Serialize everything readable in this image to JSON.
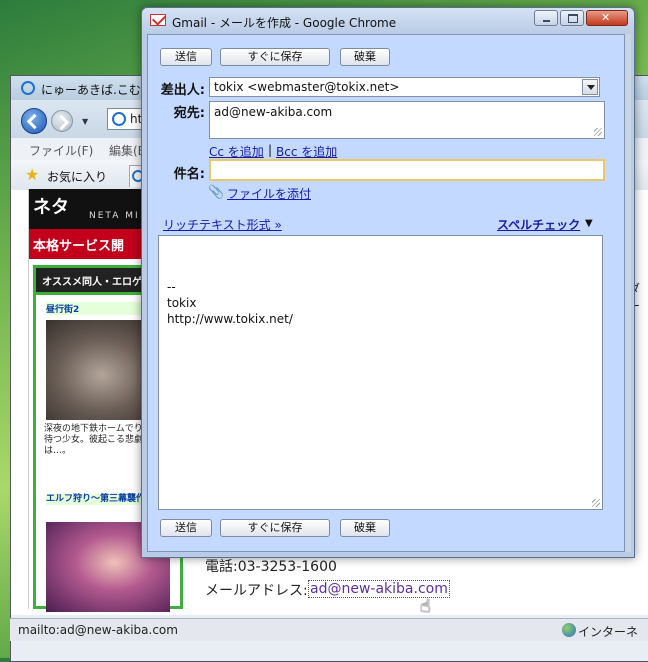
{
  "ie": {
    "title": "にゅーあきば.こむ",
    "address_text": "htt",
    "menu": [
      "ファイル(F)",
      "編集(E"
    ],
    "favorites_label": "お気に入り",
    "sidebar": {
      "banner_logo": "ネタ",
      "banner_sub": "NETA MI",
      "banner_text": "本格サービス開",
      "box_header": "オススメ同人・エロゲ",
      "item1_title": "昼行街2",
      "item1_desc": "深夜の地下鉄ホームでり電車を待つ少女。彼起こる悲劇とは…。",
      "item2_title": "エルフ狩り～第三幕襲作戦～"
    },
    "right_edge_1": "ダー",
    "right_edge_2": "",
    "phone_text": "電話:03-3253-1600",
    "email_label": "メールアドレス:",
    "email_link": "ad@new-akiba.com",
    "status_text": "mailto:ad@new-akiba.com",
    "zone_text": "インターネ"
  },
  "chrome": {
    "title": "Gmail - メールを作成 - Google Chrome",
    "buttons": {
      "send": "送信",
      "save": "すぐに保存",
      "discard": "破棄"
    },
    "from_label": "差出人:",
    "from_value": "tokix <webmaster@tokix.net>",
    "to_label": "宛先:",
    "to_value": "ad@new-akiba.com",
    "cc_link": "Cc を追加",
    "separator": "|",
    "bcc_link": "Bcc を追加",
    "subject_label": "件名:",
    "subject_value": "",
    "attach_link": "ファイルを添付",
    "rich_text_link": "リッチテキスト形式 »",
    "spell_check": "スペルチェック",
    "spell_arrow": "▼",
    "body_lines": [
      "--",
      "tokix",
      "http://www.tokix.net/"
    ]
  }
}
